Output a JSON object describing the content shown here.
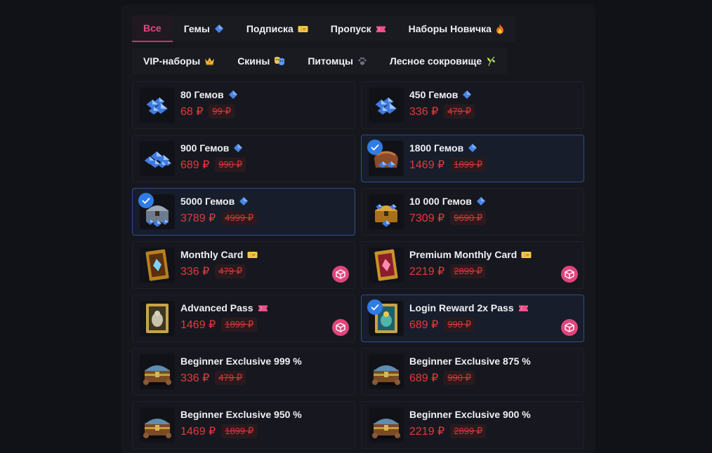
{
  "tabs_row1": [
    {
      "label": "Все",
      "icon": "",
      "active": true
    },
    {
      "label": "Гемы",
      "icon": "gem-icon"
    },
    {
      "label": "Подписка",
      "icon": "ticket-icon"
    },
    {
      "label": "Пропуск",
      "icon": "pass-icon"
    },
    {
      "label": "Наборы Новичка",
      "icon": "fire-icon"
    }
  ],
  "tabs_row2": [
    {
      "label": "VIP-наборы",
      "icon": "crown-icon"
    },
    {
      "label": "Скины",
      "icon": "masks-icon"
    },
    {
      "label": "Питомцы",
      "icon": "paw-icon"
    },
    {
      "label": "Лесное сокровище",
      "icon": "leaf-icon"
    }
  ],
  "items": [
    {
      "name": "80 Гемов",
      "price": "68 ₽",
      "old": "99 ₽",
      "icon": "gem-icon",
      "thumb": "gems-small",
      "selected": false,
      "cube": false
    },
    {
      "name": "450 Гемов",
      "price": "336 ₽",
      "old": "479 ₽",
      "icon": "gem-icon",
      "thumb": "gems-small",
      "selected": false,
      "cube": false
    },
    {
      "name": "900 Гемов",
      "price": "689 ₽",
      "old": "990 ₽",
      "icon": "gem-icon",
      "thumb": "gems-pile",
      "selected": false,
      "cube": false
    },
    {
      "name": "1800 Гемов",
      "price": "1469 ₽",
      "old": "1899 ₽",
      "icon": "gem-icon",
      "thumb": "gem-bag",
      "selected": true,
      "cube": false
    },
    {
      "name": "5000 Гемов",
      "price": "3789 ₽",
      "old": "4999 ₽",
      "icon": "gem-icon",
      "thumb": "gem-chest-silver",
      "selected": true,
      "cube": false
    },
    {
      "name": "10 000 Гемов",
      "price": "7309 ₽",
      "old": "9690 ₽",
      "icon": "gem-icon",
      "thumb": "gem-chest-gold",
      "selected": false,
      "cube": false
    },
    {
      "name": "Monthly Card",
      "price": "336 ₽",
      "old": "479 ₽",
      "icon": "ticket-icon",
      "thumb": "card-gold",
      "selected": false,
      "cube": true
    },
    {
      "name": "Premium Monthly Card",
      "price": "2219 ₽",
      "old": "2899 ₽",
      "icon": "ticket-icon",
      "thumb": "card-red",
      "selected": false,
      "cube": true
    },
    {
      "name": "Advanced Pass",
      "price": "1469 ₽",
      "old": "1899 ₽",
      "icon": "pass-icon",
      "thumb": "pass-card",
      "selected": false,
      "cube": true
    },
    {
      "name": "Login Reward 2x Pass",
      "price": "689 ₽",
      "old": "990 ₽",
      "icon": "pass-icon",
      "thumb": "pass-card-blue",
      "selected": true,
      "cube": true
    },
    {
      "name": "Beginner Exclusive 999 %",
      "price": "336 ₽",
      "old": "479 ₽",
      "icon": "",
      "thumb": "chest",
      "selected": false,
      "cube": false
    },
    {
      "name": "Beginner Exclusive 875 %",
      "price": "689 ₽",
      "old": "990 ₽",
      "icon": "",
      "thumb": "chest",
      "selected": false,
      "cube": false
    },
    {
      "name": "Beginner Exclusive 950 %",
      "price": "1469 ₽",
      "old": "1899 ₽",
      "icon": "",
      "thumb": "chest",
      "selected": false,
      "cube": false
    },
    {
      "name": "Beginner Exclusive 900 %",
      "price": "2219 ₽",
      "old": "2899 ₽",
      "icon": "",
      "thumb": "chest",
      "selected": false,
      "cube": false
    }
  ],
  "colors": {
    "accent": "#e9457f",
    "price": "#e23b3b",
    "selected_border": "#2b4f89",
    "check": "#2f7ce6",
    "cube": "#e0457b"
  }
}
